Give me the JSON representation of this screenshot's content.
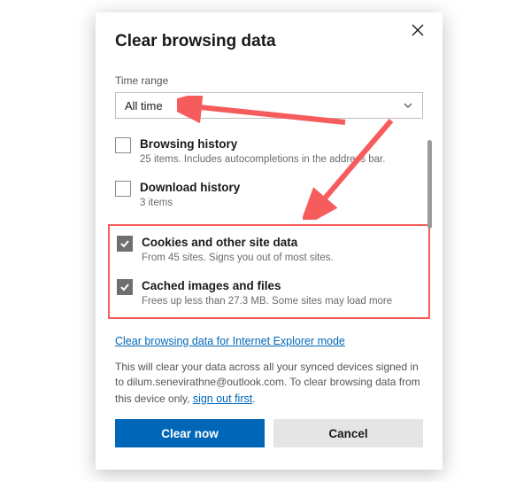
{
  "dialog": {
    "title": "Clear browsing data",
    "time_range_label": "Time range",
    "time_range_value": "All time",
    "options": {
      "browsing_history": {
        "title": "Browsing history",
        "desc": "25 items. Includes autocompletions in the address bar.",
        "checked": false
      },
      "download_history": {
        "title": "Download history",
        "desc": "3 items",
        "checked": false
      },
      "cookies": {
        "title": "Cookies and other site data",
        "desc": "From 45 sites. Signs you out of most sites.",
        "checked": true
      },
      "cache": {
        "title": "Cached images and files",
        "desc": "Frees up less than 27.3 MB. Some sites may load more",
        "checked": true
      }
    },
    "ie_link": "Clear browsing data for Internet Explorer mode",
    "note_prefix": "This will clear your data across all your synced devices signed in to dilum.senevirathne@outlook.com. To clear browsing data from this device only, ",
    "note_link": "sign out first",
    "note_suffix": ".",
    "buttons": {
      "primary": "Clear now",
      "secondary": "Cancel"
    }
  },
  "annotations": {
    "highlight_color": "#f75c5c"
  }
}
